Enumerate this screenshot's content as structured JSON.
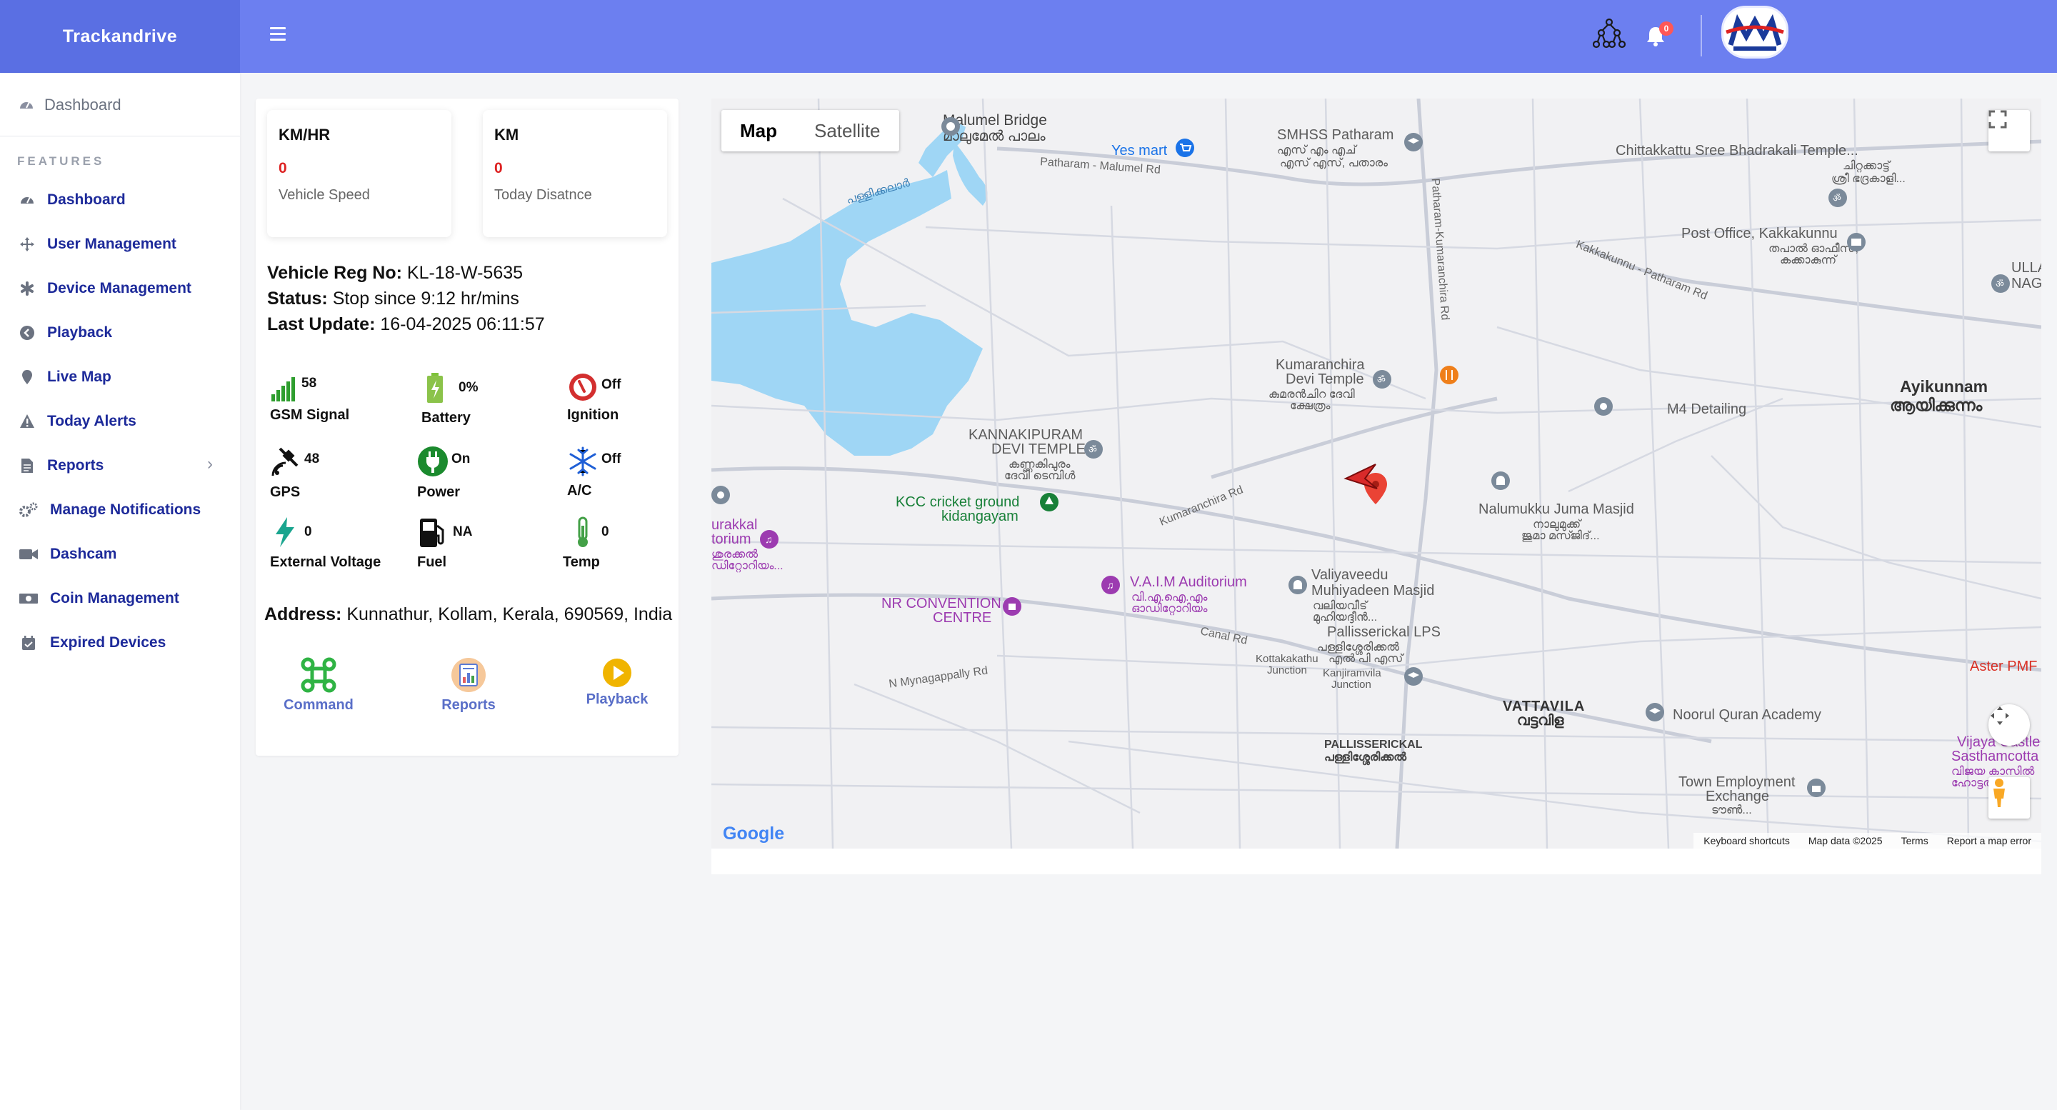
{
  "app": {
    "brand": "Trackandrive"
  },
  "header": {
    "notification_count": "0"
  },
  "sidebar": {
    "top_item": "Dashboard",
    "section_label": "FEATURES",
    "items": [
      {
        "label": "Dashboard",
        "icon": "dashboard-icon"
      },
      {
        "label": "User Management",
        "icon": "move-icon"
      },
      {
        "label": "Device Management",
        "icon": "asterisk-icon"
      },
      {
        "label": "Playback",
        "icon": "playback-icon"
      },
      {
        "label": "Live Map",
        "icon": "pin-icon"
      },
      {
        "label": "Today Alerts",
        "icon": "warning-icon"
      },
      {
        "label": "Reports",
        "icon": "file-icon"
      },
      {
        "label": "Manage Notifications",
        "icon": "gears-icon"
      },
      {
        "label": "Dashcam",
        "icon": "video-icon"
      },
      {
        "label": "Coin Management",
        "icon": "money-icon"
      },
      {
        "label": "Expired Devices",
        "icon": "calendar-icon"
      }
    ]
  },
  "vehicle": {
    "speed": {
      "unit": "KM/HR",
      "value": "0",
      "label": "Vehicle Speed"
    },
    "distance": {
      "unit": "KM",
      "value": "0",
      "label": "Today Disatnce"
    },
    "reg_label": "Vehicle Reg No:",
    "reg_value": "KL-18-W-5635",
    "status_label": "Status:",
    "status_value": "Stop since 9:12 hr/mins",
    "update_label": "Last Update:",
    "update_value": "16-04-2025 06:11:57",
    "metrics": {
      "gsm": {
        "value": "58",
        "label": "GSM Signal"
      },
      "battery": {
        "value": "0%",
        "label": "Battery"
      },
      "ignition": {
        "value": "Off",
        "label": "Ignition"
      },
      "gps": {
        "value": "48",
        "label": "GPS"
      },
      "power": {
        "value": "On",
        "label": "Power"
      },
      "ac": {
        "value": "Off",
        "label": "A/C"
      },
      "ext_voltage": {
        "value": "0",
        "label": "External Voltage"
      },
      "fuel": {
        "value": "NA",
        "label": "Fuel"
      },
      "temp": {
        "value": "0",
        "label": "Temp"
      }
    },
    "address_label": "Address:",
    "address_value": "Kunnathur, Kollam, Kerala, 690569, India",
    "actions": {
      "command": "Command",
      "reports": "Reports",
      "playback": "Playback"
    }
  },
  "map": {
    "type_map": "Map",
    "type_satellite": "Satellite",
    "google": "Google",
    "footer": {
      "shortcuts": "Keyboard shortcuts",
      "data": "Map data ©2025",
      "terms": "Terms",
      "report": "Report a map error"
    },
    "labels": {
      "malumel_bridge": "Malumel Bridge",
      "malumel_bridge_ml": "മാലുമേൽ പാലം",
      "yes_mart": "Yes mart",
      "smhss": "SMHSS Patharam",
      "smhss_ml": "എസ് എം എച്",
      "smhss_ml2": "എസ് എസ്, പതാരം",
      "chittakattu": "Chittakkattu Sree Bhadrakali Temple...",
      "chittakattu_ml": "ചിറ്റക്കാട്ട്",
      "chittakattu_ml2": "ശ്രീ ഭദ്രകാളി...",
      "post_office": "Post Office, Kakkakunnu",
      "post_office_ml": "തപാൽ ഓഫീസ്,",
      "post_office_ml2": "കക്കാകുന്ന്",
      "ullai": "ULLAI",
      "naga": "NAGA",
      "kumaranchira_temple": "Kumaranchira",
      "kumaranchira_temple2": "Devi Temple",
      "kumaranchira_ml": "കുമരൻചിറ ദേവി",
      "kumaranchira_ml2": "ക്ഷേത്രം",
      "ayikunnam": "Ayikunnam",
      "ayikunnam_ml": "ആയിക്കുന്നം",
      "m4": "M4 Detailing",
      "kannakipuram": "KANNAKIPURAM",
      "kannakipuram2": "DEVI TEMPLE",
      "kannakipuram_ml": "കണ്ണകിപുരം",
      "kannakipuram_ml2": "ദേവി ടെമ്പിൾ",
      "kcc": "KCC cricket ground",
      "kcc2": "kidangayam",
      "nalumukku": "Nalumukku Juma Masjid",
      "nalumukku_ml": "നാലുമുക്ക്",
      "nalumukku_ml2": "ജുമാ മസ്ജിദ്...",
      "urakkal": "urakkal",
      "urakkal2": "torium",
      "urakkal_ml": "ശുരക്കൽ",
      "urakkal_ml2": "ഡിറ്റോറിയം...",
      "vaim": "V.A.I.M Auditorium",
      "vaim_ml": "വി.എ.ഐ.എം",
      "vaim_ml2": "ഓഡിറ്റോറിയം",
      "valiyaveedu": "Valiyaveedu",
      "valiyaveedu2": "Muhiyadeen Masjid",
      "valiyaveedu_ml": "വലിയവീട്",
      "valiyaveedu_ml2": "മുഹിയദ്ദീൻ...",
      "nr": "NR CONVENTION",
      "nr2": "CENTRE",
      "pallisserical_lps": "Pallisserickal LPS",
      "pallisserical_lps_ml": "പള്ളിശ്ശേരിക്കൽ",
      "pallisserical_lps_ml2": "എൽ പി എസ്",
      "kottakathu": "Kottakakathu",
      "kottakathu2": "Junction",
      "kanjiramvila": "Kanjiramvila",
      "kanjiramvila2": "Junction",
      "aster": "Aster PMF",
      "vattavila": "VATTAVILA",
      "vattavila_ml": "വട്ടവിള",
      "noorul": "Noorul Quran Academy",
      "pallissericakal": "PALLISSERICKAL",
      "pallissericakal_ml": "പള്ളിശ്ശേരിക്കൽ",
      "vijaya": "Vijaya Castle",
      "vijaya2": "Sasthamcotta",
      "vijaya_ml": "വിജയ കാസിൽ",
      "vijaya_ml2": "ഹോട്ടൽ ശാ",
      "town_employment": "Town Employment",
      "town_employment2": "Exchange",
      "town_employment_ml": "ടൗൺ...",
      "road_patharam_malumel": "Patharam - Malumel Rd",
      "road_kumaranchira": "Patharam-Kumaranchira Rd",
      "road_kakkakunnu": "Kakkakunnu - Patharam Rd",
      "road_kumaranchira2": "Kumaranchira Rd",
      "road_canal": "Canal Rd",
      "road_mynagappally": "N Mynagappally Rd",
      "river_label": "പള്ളിക്കലാർ"
    }
  }
}
